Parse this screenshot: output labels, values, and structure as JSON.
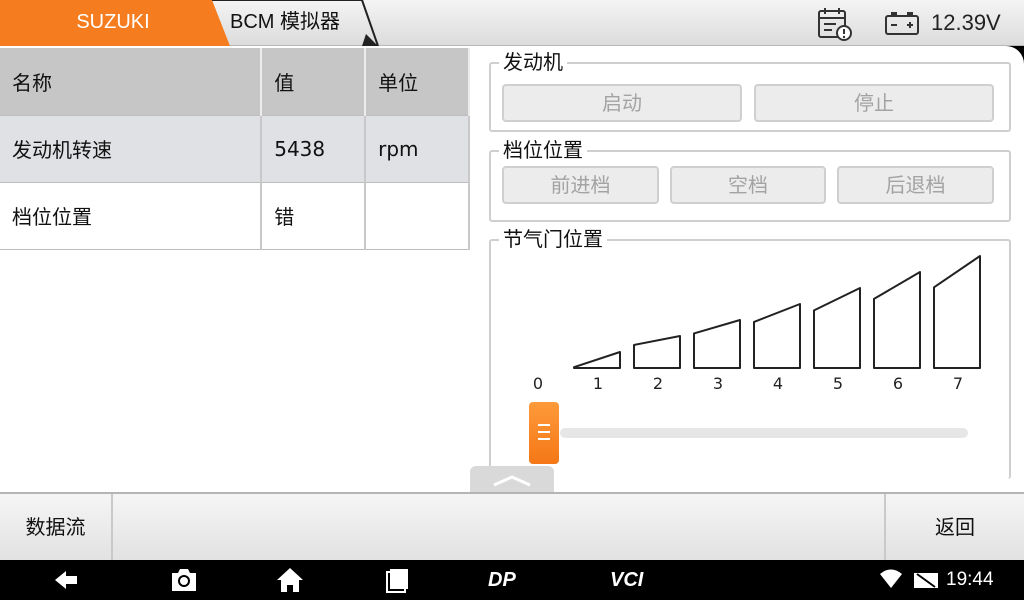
{
  "header": {
    "brand_tab": "SUZUKI",
    "module_tab": "BCM 模拟器",
    "voltage": "12.39V",
    "icons": [
      "calendar-alert-icon",
      "battery-icon"
    ],
    "accent_color": "#f57c1f"
  },
  "table": {
    "columns": [
      "名称",
      "值",
      "单位"
    ],
    "rows": [
      {
        "name": "发动机转速",
        "value": "5438",
        "unit": "rpm"
      },
      {
        "name": "档位位置",
        "value": "错",
        "unit": ""
      }
    ]
  },
  "engine": {
    "title": "发动机",
    "start_label": "启动",
    "stop_label": "停止"
  },
  "gear": {
    "title": "档位位置",
    "forward_label": "前进档",
    "neutral_label": "空档",
    "reverse_label": "后退档"
  },
  "throttle": {
    "title": "节气门位置",
    "levels": [
      "0",
      "1",
      "2",
      "3",
      "4",
      "5",
      "6",
      "7"
    ],
    "current_level": 0
  },
  "footer": {
    "datastream_label": "数据流",
    "back_label": "返回"
  },
  "navbar": {
    "dp_label": "DP",
    "vci_label": "VCI",
    "clock": "19:44",
    "icons": [
      "back-icon",
      "camera-icon",
      "home-icon",
      "recent-apps-icon",
      "wifi-icon",
      "sim-icon"
    ]
  }
}
